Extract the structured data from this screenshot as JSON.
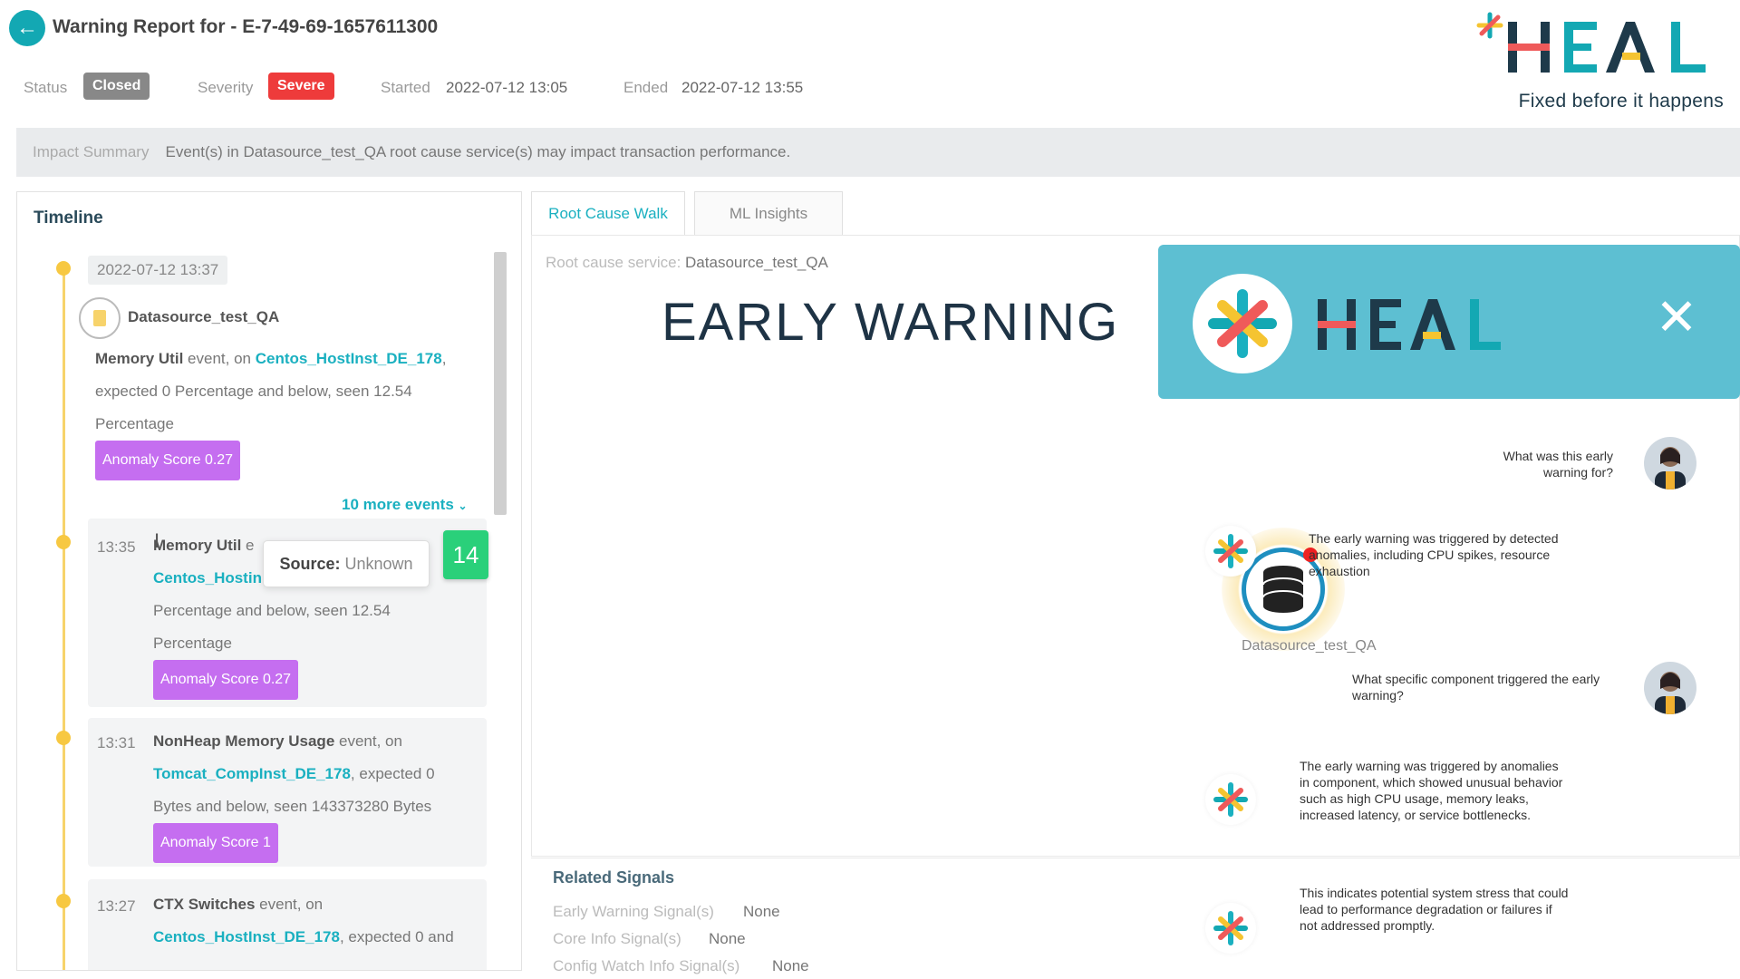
{
  "header": {
    "title": "Warning Report for - E-7-49-69-1657611300",
    "status_label": "Status",
    "status_value": "Closed",
    "severity_label": "Severity",
    "severity_value": "Severe",
    "started_label": "Started",
    "started_value": "2022-07-12 13:05",
    "ended_label": "Ended",
    "ended_value": "2022-07-12 13:55"
  },
  "brand": {
    "name": "HEAL",
    "tagline": "Fixed before it happens",
    "colors": {
      "teal": "#13a8b3",
      "yellow": "#f5c431",
      "red": "#ef5a5a",
      "navy": "#1e3a4a"
    }
  },
  "impact": {
    "label": "Impact Summary",
    "text": "Event(s) in Datasource_test_QA root cause service(s) may impact transaction performance."
  },
  "timeline": {
    "title": "Timeline",
    "date": "2022-07-12 13:37",
    "service": "Datasource_test_QA",
    "first_event": {
      "metric": "Memory Util",
      "event_on": "event, on",
      "host": "Centos_HostInst_DE_178",
      "rest1": "expected 0 Percentage and below, seen 12.54",
      "rest2": "Percentage",
      "score": "Anomaly Score 0.27"
    },
    "more_events": "10 more events",
    "events": [
      {
        "time": "13:35",
        "metric": "Memory Util",
        "frag": "e",
        "host": "Centos_Hostin",
        "line2": "Percentage and below, seen 12.54",
        "line3": "Percentage",
        "score": "Anomaly Score 0.27"
      },
      {
        "time": "13:31",
        "metric": "NonHeap Memory Usage",
        "event_on": "event, on",
        "host": "Tomcat_CompInst_DE_178",
        "after_host": ", expected 0",
        "line2": "Bytes and below, seen 143373280 Bytes",
        "score": "Anomaly Score 1"
      },
      {
        "time": "13:27",
        "metric": "CTX Switches",
        "event_on": "event, on",
        "host": "Centos_HostInst_DE_178",
        "after_host": ", expected 0 and"
      }
    ],
    "tooltip_label": "Source:",
    "tooltip_value": "Unknown",
    "count_badge": "14"
  },
  "tabs": [
    {
      "label": "Root Cause Walk",
      "active": true
    },
    {
      "label": "ML Insights",
      "active": false
    }
  ],
  "root_cause": {
    "label": "Root cause service:",
    "value": "Datasource_test_QA",
    "node_label": "Datasource_test_QA"
  },
  "overlay": {
    "heading": "EARLY WARNING",
    "banner_brand": "HEAL"
  },
  "chat": [
    {
      "role": "user",
      "text": "What was this early warning for?"
    },
    {
      "role": "bot",
      "text": "The early warning was triggered by detected anomalies, including CPU spikes, resource exhaustion"
    },
    {
      "role": "user",
      "text": "What specific component triggered the early warning?"
    },
    {
      "role": "bot",
      "text": "The early warning was triggered by anomalies in component, which showed unusual behavior such as high CPU usage, memory leaks, increased latency, or service bottlenecks."
    },
    {
      "role": "bot",
      "text": "This indicates potential system stress that could lead to performance degradation or failures if not addressed promptly."
    }
  ],
  "related": {
    "title": "Related Signals",
    "items": [
      {
        "label": "Early Warning Signal(s)",
        "value": "None"
      },
      {
        "label": "Core Info Signal(s)",
        "value": "None"
      },
      {
        "label": "Config Watch Info Signal(s)",
        "value": "None"
      }
    ]
  }
}
